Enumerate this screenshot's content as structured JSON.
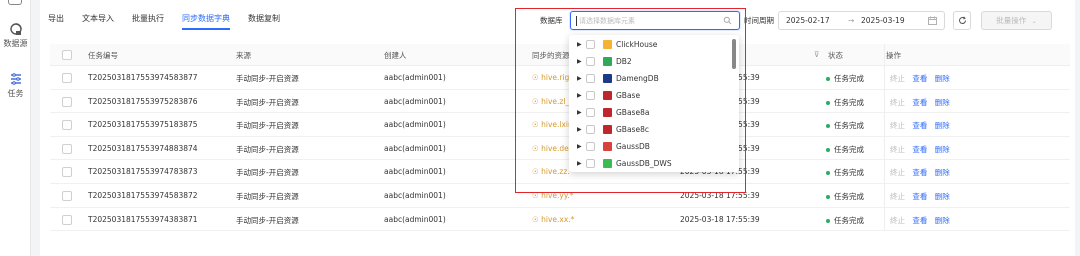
{
  "nav": {
    "items": [
      {
        "label": "数据源",
        "icon": "datasource-icon"
      },
      {
        "label": "任务",
        "icon": "task-icon"
      }
    ]
  },
  "tabs": [
    "导出",
    "文本导入",
    "批量执行",
    "同步数据字典",
    "数据复制"
  ],
  "active_tab": "同步数据字典",
  "filters": {
    "db_label": "数据库",
    "db_placeholder": "请选择数据库元素",
    "time_label": "时间周期",
    "date_start": "2025-02-17",
    "date_arrow": "→",
    "date_end": "2025-03-19",
    "batch_label": "批量操作"
  },
  "table": {
    "headers": {
      "id": "任务编号",
      "source": "来源",
      "creator": "创建人",
      "sync_resource": "同步的资源",
      "status": "状态",
      "ops": "操作"
    },
    "rows": [
      {
        "id": "T2025031817553974583877",
        "source": "手动同步-开启资源",
        "creator": "aabc(admin001)",
        "resource": "hive.righ",
        "time": "2025-03-18 17:55:39",
        "status": "任务完成"
      },
      {
        "id": "T2025031817553975283876",
        "source": "手动同步-开启资源",
        "creator": "aabc(admin001)",
        "resource": "hive.zl_h",
        "time": "2025-03-18 17:55:39",
        "status": "任务完成"
      },
      {
        "id": "T2025031817553975183875",
        "source": "手动同步-开启资源",
        "creator": "aabc(admin001)",
        "resource": "hive.lxin",
        "time": "2025-03-18 17:55:39",
        "status": "任务完成"
      },
      {
        "id": "T2025031817553974883874",
        "source": "手动同步-开启资源",
        "creator": "aabc(admin001)",
        "resource": "hive.des",
        "time": "2025-03-18 17:55:39",
        "status": "任务完成"
      },
      {
        "id": "T2025031817553974783873",
        "source": "手动同步-开启资源",
        "creator": "aabc(admin001)",
        "resource": "hive.zz.*",
        "time": "2025-03-18 17:55:39",
        "status": "任务完成"
      },
      {
        "id": "T2025031817553974583872",
        "source": "手动同步-开启资源",
        "creator": "aabc(admin001)",
        "resource": "hive.yy.*",
        "time": "2025-03-18 17:55:39",
        "status": "任务完成"
      },
      {
        "id": "T2025031817553974383871",
        "source": "手动同步-开启资源",
        "creator": "aabc(admin001)",
        "resource": "hive.xx.*",
        "time": "2025-03-18 17:55:39",
        "status": "任务完成"
      }
    ],
    "ops": {
      "stop": "终止",
      "view": "查看",
      "delete": "删除"
    }
  },
  "dropdown": {
    "options": [
      {
        "name": "ClickHouse",
        "color": "#f5b335"
      },
      {
        "name": "DB2",
        "color": "#2eaa5a"
      },
      {
        "name": "DamengDB",
        "color": "#1d3a8a"
      },
      {
        "name": "GBase",
        "color": "#c0272d"
      },
      {
        "name": "GBase8a",
        "color": "#c0272d"
      },
      {
        "name": "GBase8c",
        "color": "#c0272d"
      },
      {
        "name": "GaussDB",
        "color": "#d6453d"
      },
      {
        "name": "GaussDB_DWS",
        "color": "#3cba54"
      }
    ]
  },
  "colors": {
    "accent": "#2f6bff",
    "success": "#27ae60",
    "highlight": "#e0262a"
  }
}
